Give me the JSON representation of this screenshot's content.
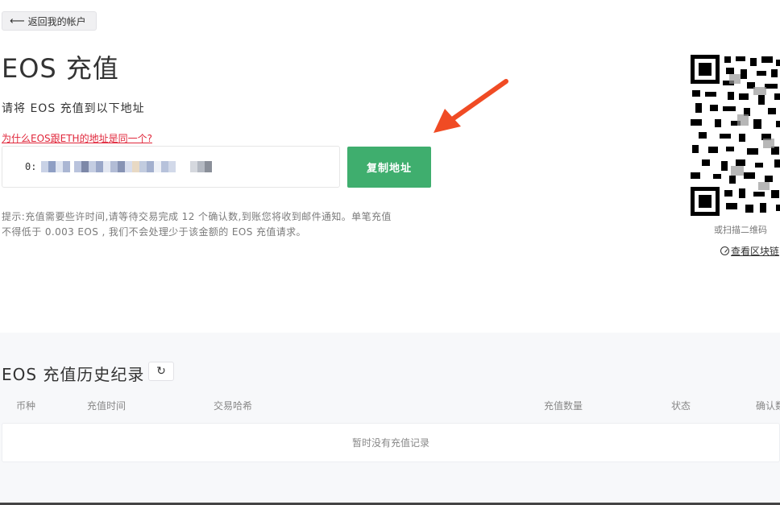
{
  "header": {
    "back_label": "返回我的帐户",
    "back_icon": "arrow-left-icon"
  },
  "deposit": {
    "title": "EOS 充值",
    "subtitle": "请将 EOS 充值到以下地址",
    "why_link": "为什么EOS跟ETH的地址是同一个?",
    "address_prefix": "0:",
    "copy_label": "复制地址",
    "tip_line1": "提示:充值需要些许时间,请等待交易完成 12 个确认数,到账您将收到邮件通知。单笔充值",
    "tip_line2": "不得低于 0.003 EOS , 我们不会处理少于该金额的 EOS 充值请求。",
    "copy_button_color": "#3fae6e",
    "annotation_arrow_color": "#f04b24",
    "link_color": "#e0263a"
  },
  "qr": {
    "caption": "或扫描二维码",
    "chain_link": "查看区块链",
    "chain_icon": "compass-icon"
  },
  "history": {
    "title": "EOS 充值历史纪录",
    "refresh_icon": "refresh-icon",
    "columns": [
      "币种",
      "充值时间",
      "交易哈希",
      "充值数量",
      "状态",
      "确认数"
    ],
    "empty_text": "暂时没有充值记录"
  }
}
